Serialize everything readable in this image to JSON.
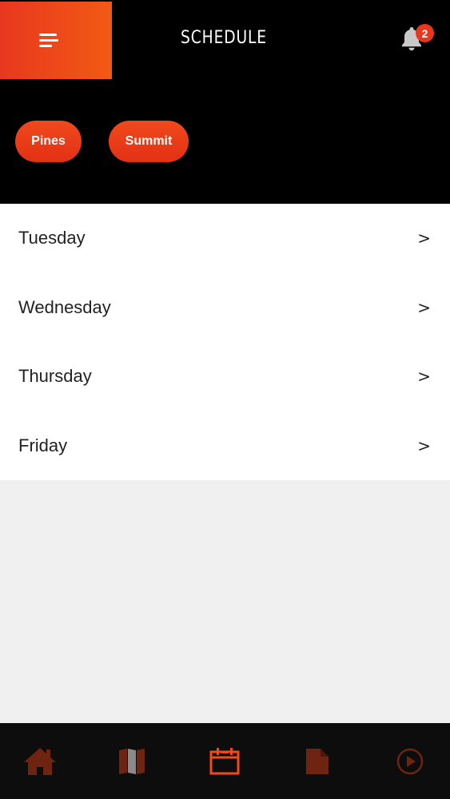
{
  "header": {
    "title": "SCHEDULE",
    "menu_icon": "hamburger-menu-icon",
    "notifications": {
      "icon": "bell-icon",
      "count": "2"
    }
  },
  "filters": [
    {
      "label": "Pines"
    },
    {
      "label": "Summit"
    }
  ],
  "days": [
    {
      "label": "Tuesday",
      "chevron": ">"
    },
    {
      "label": "Wednesday",
      "chevron": ">"
    },
    {
      "label": "Thursday",
      "chevron": ">"
    },
    {
      "label": "Friday",
      "chevron": ">"
    }
  ],
  "tabbar": {
    "items": [
      {
        "icon": "home-icon",
        "active": false
      },
      {
        "icon": "map-icon",
        "active": false
      },
      {
        "icon": "calendar-icon",
        "active": true
      },
      {
        "icon": "document-icon",
        "active": false
      },
      {
        "icon": "play-icon",
        "active": false
      }
    ]
  },
  "colors": {
    "accent": "#f04a1c",
    "accent_dark": "#e23014",
    "header_bg": "#000000",
    "list_bg": "#ffffff",
    "empty_bg": "#f0f0f0",
    "tabbar_bg": "#0d0d0d",
    "inactive_icon": "#6e2411"
  }
}
